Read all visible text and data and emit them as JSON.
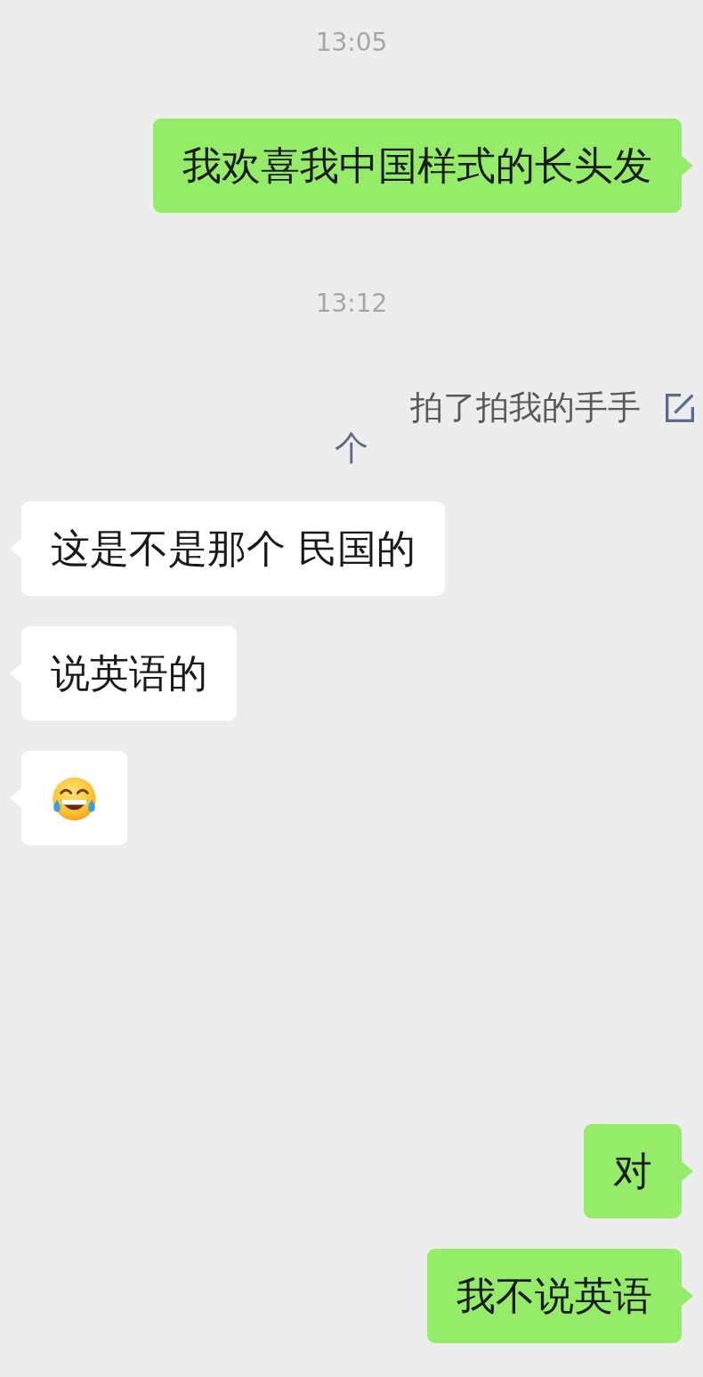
{
  "chat_top": [
    {
      "kind": "time",
      "text": "13:05"
    },
    {
      "kind": "text",
      "outgoing": true,
      "text": "我欢喜我中国样式的长头发"
    },
    {
      "kind": "time",
      "text": "13:12"
    },
    {
      "kind": "pat",
      "text": "拍了拍我的手手",
      "second_line": "个"
    },
    {
      "kind": "text",
      "outgoing": false,
      "text": "这是不是那个 民国的"
    },
    {
      "kind": "text",
      "outgoing": false,
      "text": "说英语的"
    },
    {
      "kind": "emoji",
      "outgoing": false
    }
  ],
  "chat_bottom": [
    {
      "kind": "text",
      "outgoing": true,
      "text": "对"
    },
    {
      "kind": "text",
      "outgoing": true,
      "text": "我不说英语"
    }
  ]
}
